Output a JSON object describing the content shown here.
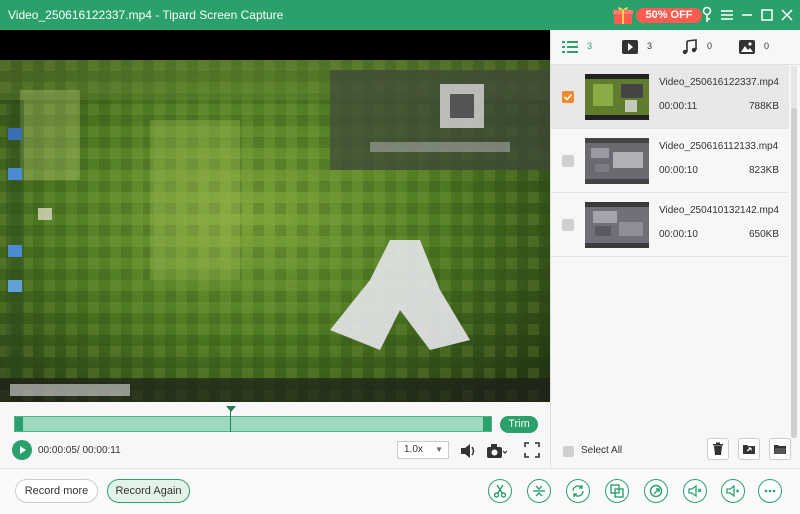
{
  "window": {
    "title": "Video_250616122337.mp4 - Tipard Screen Capture",
    "promo_label": "50% OFF"
  },
  "player": {
    "current_time": "00:00:05/ 00:00:11",
    "speed": "1.0x",
    "trim_label": "Trim"
  },
  "sidebar": {
    "tabs": [
      {
        "name": "list",
        "count": "3"
      },
      {
        "name": "video",
        "count": "3"
      },
      {
        "name": "audio",
        "count": "0"
      },
      {
        "name": "image",
        "count": "0"
      }
    ],
    "files": [
      {
        "name": "Video_250616122337.mp4",
        "duration": "00:00:11",
        "size": "788KB",
        "selected": true
      },
      {
        "name": "Video_250616112133.mp4",
        "duration": "00:00:10",
        "size": "823KB",
        "selected": false
      },
      {
        "name": "Video_250410132142.mp4",
        "duration": "00:00:10",
        "size": "650KB",
        "selected": false
      }
    ],
    "select_all_label": "Select All"
  },
  "bottom": {
    "record_more_label": "Record more",
    "record_again_label": "Record Again",
    "tools": [
      "scissors-icon",
      "split-icon",
      "convert-icon",
      "merge-icon",
      "compress-icon",
      "volume-edit-icon",
      "audio-boost-icon",
      "more-icon"
    ]
  },
  "colors": {
    "accent": "#2aa06a",
    "promo": "#ff5b50",
    "checked": "#f08a2c"
  }
}
